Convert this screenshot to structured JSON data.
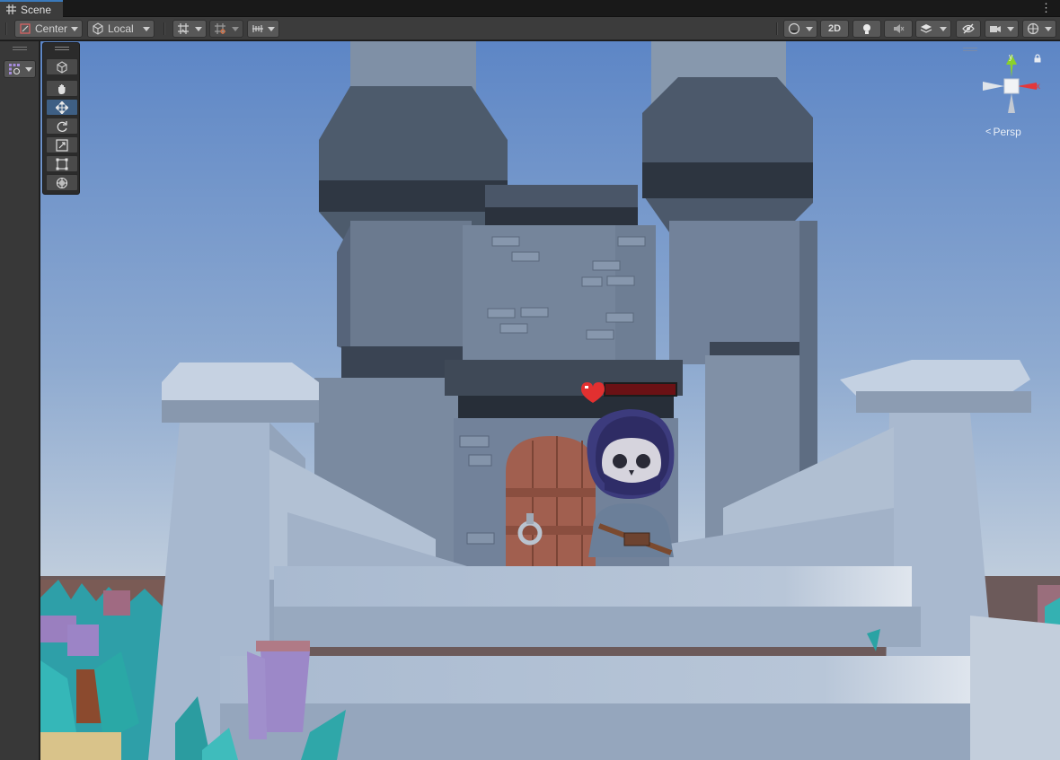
{
  "window": {
    "tab_label": "Scene"
  },
  "toolbar": {
    "pivot_mode": "Center",
    "pivot_rotation": "Local",
    "view_2d_label": "2D"
  },
  "gizmo": {
    "axis_x": "x",
    "axis_y": "y",
    "projection": "Persp"
  },
  "tools": {
    "items": [
      "view-tool",
      "move-tool",
      "rotate-tool",
      "scale-tool",
      "rect-tool",
      "transform-tool"
    ],
    "active": "move-tool"
  },
  "colors": {
    "accent": "#3a79bb",
    "active_tool": "#3e5f84",
    "sky_top": "#5e86c4",
    "sky_horizon": "#c3cfdc",
    "x_axis": "#e4373b",
    "y_axis": "#8bd22a"
  }
}
